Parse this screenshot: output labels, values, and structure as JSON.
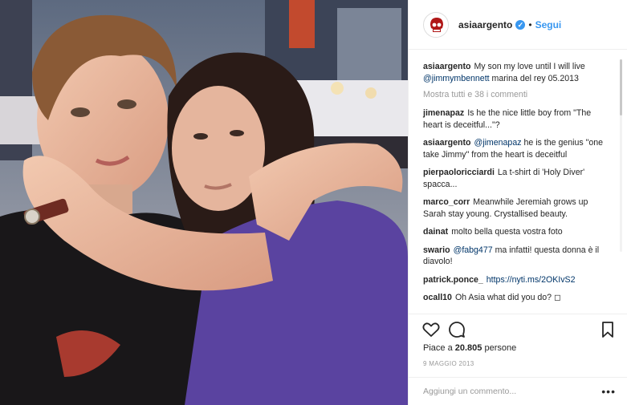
{
  "header": {
    "username": "asiaargento",
    "verified_mark": "✓",
    "separator": "•",
    "follow_label": "Segui",
    "avatar_icon": "skull-avatar-icon"
  },
  "caption": {
    "user": "asiaargento",
    "text": "My son my love until I will live",
    "mention": "@jimmymbennett",
    "tail": "marina del rey 05.2013"
  },
  "load_more": "Mostra tutti e 38 i commenti",
  "comments": [
    {
      "user": "jimenapaz",
      "text": "Is he the nice little boy from \"The heart is deceitful...\"?"
    },
    {
      "user": "asiaargento",
      "mention": "@jimenapaz",
      "text": "he is the genius \"one take Jimmy\" from the heart is deceitful"
    },
    {
      "user": "pierpaoloricciardi",
      "text": "La t-shirt di 'Holy Diver' spacca..."
    },
    {
      "user": "marco_corr",
      "text": "Meanwhile Jeremiah grows up Sarah stay young. Crystallised beauty."
    },
    {
      "user": "dainat",
      "text": "molto bella questa vostra foto"
    },
    {
      "user": "swario",
      "mention": "@fabg477",
      "text": "ma infatti! questa donna è il diavolo!"
    },
    {
      "user": "patrick.ponce_",
      "text": "https://nyti.ms/2OKIvS2"
    },
    {
      "user": "ocall10",
      "text": "Oh Asia what did you do? ◻"
    }
  ],
  "actions": {
    "like_icon": "heart-icon",
    "comment_icon": "comment-icon",
    "save_icon": "bookmark-icon"
  },
  "likes": {
    "prefix": "Piace a",
    "count": "20.805",
    "suffix": "persone"
  },
  "date": "9 MAGGIO 2013",
  "add_comment": {
    "placeholder": "Aggiungi un commento...",
    "more": "•••"
  },
  "colors": {
    "link": "#003569",
    "accent": "#3897f0",
    "muted": "#999999",
    "text": "#262626"
  }
}
